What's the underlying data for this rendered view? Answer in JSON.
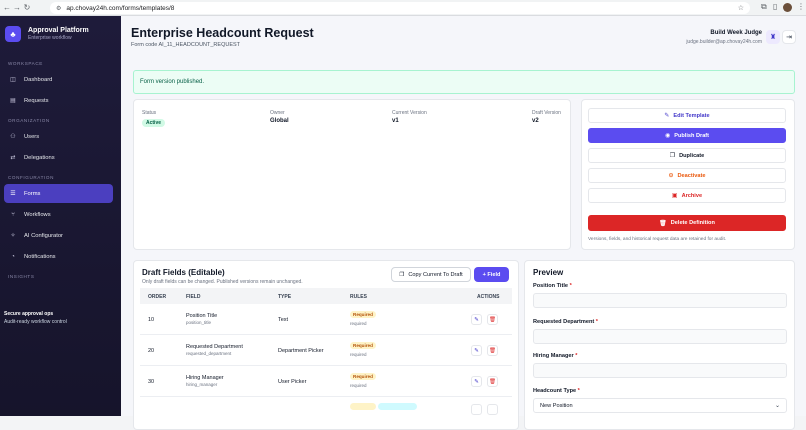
{
  "browser": {
    "url": "ap.chovay24h.com/forms/templates/8"
  },
  "sidebar": {
    "app_name": "Approval Platform",
    "app_subtitle": "Enterprise workflow",
    "sections": {
      "workspace": "WORKSPACE",
      "organization": "ORGANIZATION",
      "configuration": "CONFIGURATION",
      "insights": "INSIGHTS"
    },
    "items": [
      {
        "label": "Dashboard",
        "icon": "dashboard-icon"
      },
      {
        "label": "Requests",
        "icon": "document-icon"
      },
      {
        "label": "Users",
        "icon": "users-icon"
      },
      {
        "label": "Delegations",
        "icon": "delegation-icon"
      },
      {
        "label": "Forms",
        "icon": "forms-icon"
      },
      {
        "label": "Workflows",
        "icon": "workflow-icon"
      },
      {
        "label": "AI Configurator",
        "icon": "ai-icon"
      },
      {
        "label": "Notifications",
        "icon": "bell-icon"
      }
    ],
    "footer_title": "Secure approval ops",
    "footer_text": "Audit-ready workflow control"
  },
  "header": {
    "title": "Enterprise Headcount Request",
    "form_code": "Form code AI_11_HEADCOUNT_REQUEST",
    "user_name": "Build Week Judge",
    "user_email": "judge.builder@ap.chovay24h.com"
  },
  "alert": "Form version published.",
  "status": {
    "status_label": "Status",
    "status_value": "Active",
    "owner_label": "Owner",
    "owner_value": "Global",
    "current_label": "Current Version",
    "current_value": "v1",
    "draft_label": "Draft Version",
    "draft_value": "v2"
  },
  "actions": {
    "edit": "Edit Template",
    "publish": "Publish Draft",
    "duplicate": "Duplicate",
    "deactivate": "Deactivate",
    "archive": "Archive",
    "delete": "Delete Definition",
    "note": "Versions, fields, and historical request data are retained for audit."
  },
  "fields": {
    "title": "Draft Fields (Editable)",
    "subtitle": "Only draft fields can be changed. Published versions remain unchanged.",
    "copy_button": "Copy Current To Draft",
    "add_button": "+ Field",
    "columns": [
      "ORDER",
      "FIELD",
      "TYPE",
      "RULES",
      "ACTIONS"
    ],
    "rows": [
      {
        "order": "10",
        "name": "Position Title",
        "key": "position_title",
        "type": "Text",
        "rule": "Required",
        "rule_note": "required"
      },
      {
        "order": "20",
        "name": "Requested Department",
        "key": "requested_department",
        "type": "Department Picker",
        "rule": "Required",
        "rule_note": "required"
      },
      {
        "order": "30",
        "name": "Hiring Manager",
        "key": "hiring_manager",
        "type": "User Picker",
        "rule": "Required",
        "rule_note": "required"
      }
    ]
  },
  "preview": {
    "title": "Preview",
    "fields": [
      {
        "label": "Position Title",
        "value": ""
      },
      {
        "label": "Requested Department",
        "value": ""
      },
      {
        "label": "Hiring Manager",
        "value": ""
      },
      {
        "label": "Headcount Type",
        "value": "New Position"
      }
    ]
  }
}
